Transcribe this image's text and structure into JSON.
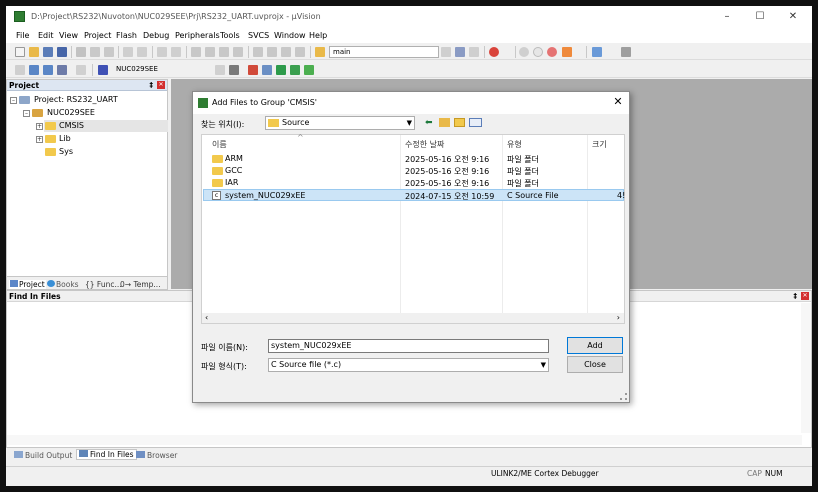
{
  "window": {
    "title": "D:\\Project\\RS232\\Nuvoton\\NUC029SEE\\Prj\\RS232_UART.uvprojx - µVision"
  },
  "menu": [
    "File",
    "Edit",
    "View",
    "Project",
    "Flash",
    "Debug",
    "Peripherals",
    "Tools",
    "SVCS",
    "Window",
    "Help"
  ],
  "toolbar": {
    "target_combo": "main",
    "target_name": "NUC029SEE"
  },
  "project_pane": {
    "header": "Project",
    "root": "Project: RS232_UART",
    "target": "NUC029SEE",
    "groups": [
      "CMSIS",
      "Lib",
      "Sys"
    ]
  },
  "project_tabs": [
    "Project",
    "Books",
    "{} Func...",
    "0→ Temp..."
  ],
  "find_pane": {
    "header": "Find In Files"
  },
  "bottom_tabs": [
    "Build Output",
    "Find In Files",
    "Browser"
  ],
  "status": {
    "debugger": "ULINK2/ME Cortex Debugger",
    "cap": "CAP",
    "num": "NUM"
  },
  "dialog": {
    "title": "Add Files to Group 'CMSIS'",
    "lookin_label": "찾는 위치(I):",
    "lookin_value": "Source",
    "columns": {
      "name": "이름",
      "date": "수정한 날짜",
      "type": "유형",
      "size": "크기"
    },
    "files": [
      {
        "name": "ARM",
        "date": "2025-05-16 오전 9:16",
        "type": "파일 폴더",
        "size": "",
        "kind": "folder"
      },
      {
        "name": "GCC",
        "date": "2025-05-16 오전 9:16",
        "type": "파일 폴더",
        "size": "",
        "kind": "folder"
      },
      {
        "name": "IAR",
        "date": "2025-05-16 오전 9:16",
        "type": "파일 폴더",
        "size": "",
        "kind": "folder"
      },
      {
        "name": "system_NUC029xEE",
        "date": "2024-07-15 오전 10:59",
        "type": "C Source File",
        "size": "4!",
        "kind": "file"
      }
    ],
    "filename_label": "파일 이름(N):",
    "filename_value": "system_NUC029xEE",
    "filetype_label": "파일 형식(T):",
    "filetype_value": "C Source file (*.c)",
    "add_label": "Add",
    "close_label": "Close"
  }
}
